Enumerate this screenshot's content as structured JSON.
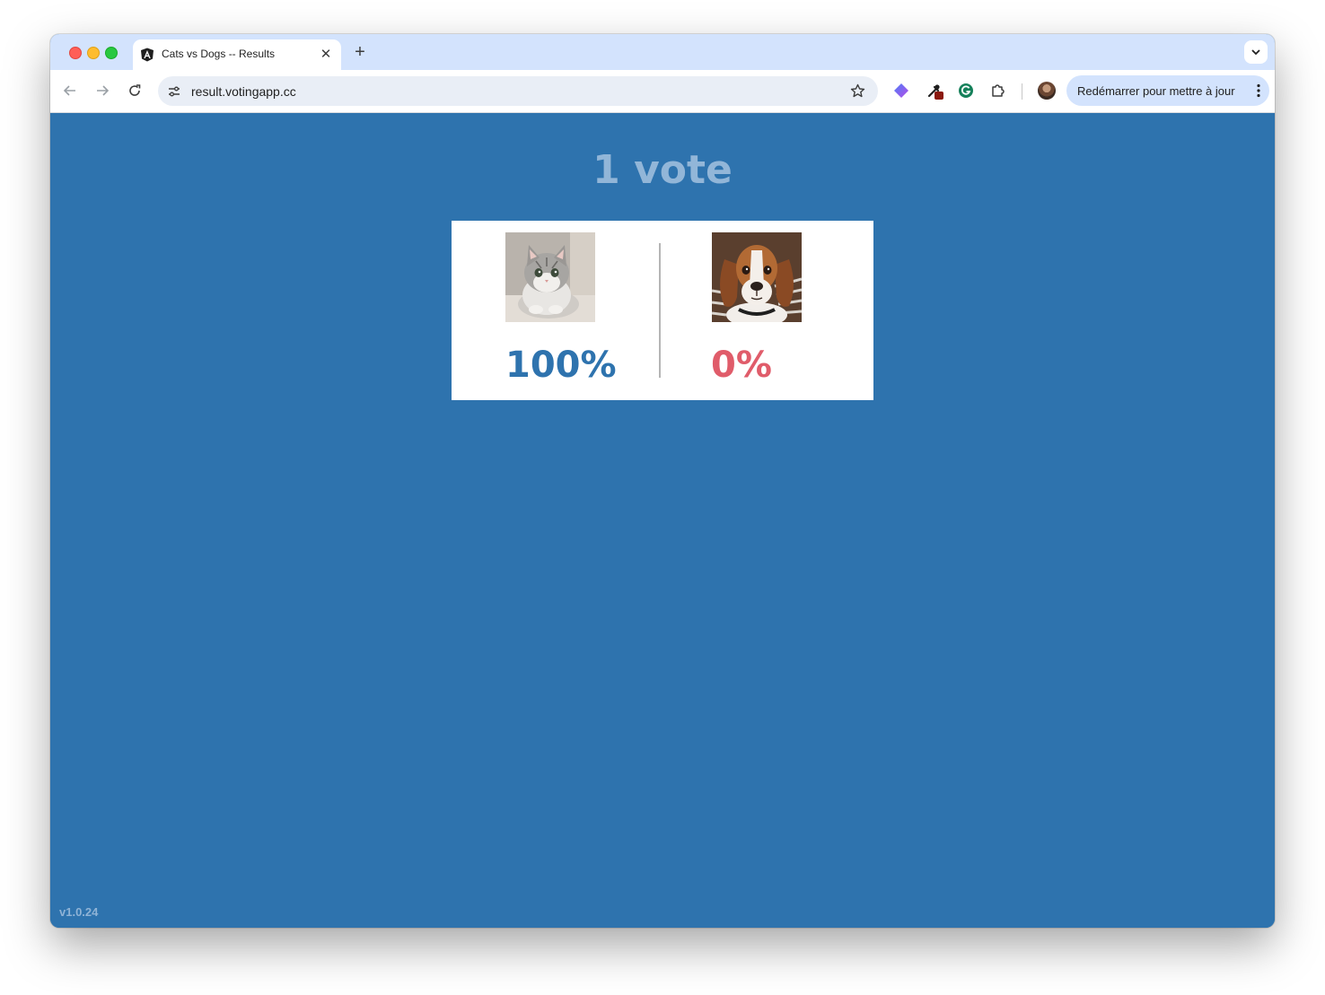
{
  "browser": {
    "tab_title": "Cats vs Dogs -- Results",
    "url": "result.votingapp.cc",
    "relaunch_label": "Redémarrer pour mettre à jour"
  },
  "results": {
    "vote_count": "1 vote",
    "option_a": {
      "name": "Cats",
      "percent_text": "100%",
      "percent": 100,
      "color": "#2e73ae"
    },
    "option_b": {
      "name": "Dogs",
      "percent_text": "0%",
      "percent": 0,
      "color": "#e05c6a"
    }
  },
  "footer": {
    "version": "v1.0.24"
  },
  "colors": {
    "page_background": "#2e73ae",
    "tabstrip": "#d3e3fd"
  }
}
